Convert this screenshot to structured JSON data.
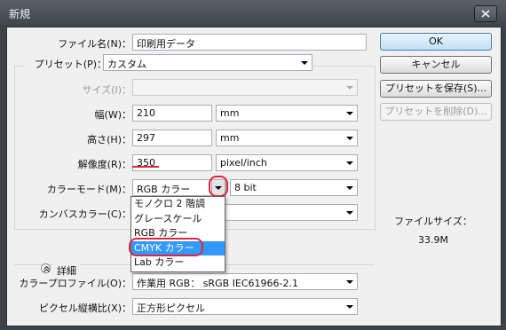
{
  "window": {
    "title": "新規"
  },
  "form": {
    "file_name": {
      "label": "ファイル名(N)：",
      "value": "印刷用データ"
    },
    "preset": {
      "label": "プリセット(P)：",
      "value": "カスタム"
    },
    "size": {
      "label": "サイズ(I)：",
      "value": ""
    },
    "width": {
      "label": "幅(W)：",
      "value": "210",
      "unit": "mm"
    },
    "height": {
      "label": "高さ(H)：",
      "value": "297",
      "unit": "mm"
    },
    "resolution": {
      "label": "解像度(R)：",
      "value": "350",
      "unit": "pixel/inch"
    },
    "color_mode": {
      "label": "カラーモード(M)：",
      "value": "RGB カラー",
      "bits": "8 bit"
    },
    "canvas_color": {
      "label": "カンバスカラー(C)："
    },
    "details": {
      "label": "詳細"
    },
    "color_profile": {
      "label": "カラープロファイル(O)：",
      "value": "作業用 RGB： sRGB IEC61966-2.1"
    },
    "pixel_aspect": {
      "label": "ピクセル縦横比(X)：",
      "value": "正方形ピクセル"
    }
  },
  "dropdown": {
    "options": [
      "モノクロ 2 階調",
      "グレースケール",
      "RGB カラー",
      "CMYK カラー",
      "Lab カラー"
    ],
    "highlighted": "CMYK カラー"
  },
  "buttons": {
    "ok": "OK",
    "cancel": "キャンセル",
    "save_preset": "プリセットを保存(S)...",
    "delete_preset": "プリセットを削除(D)..."
  },
  "info": {
    "file_size_label": "ファイルサイズ：",
    "file_size_value": "33.9M"
  },
  "colors": {
    "highlight": "#3399ff",
    "annotation": "#e0263b"
  }
}
